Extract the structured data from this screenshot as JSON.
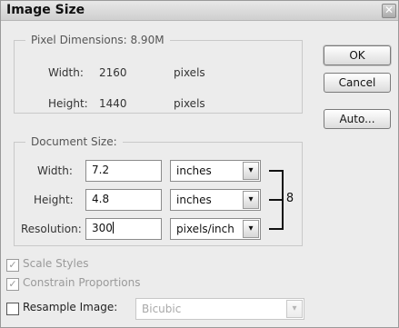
{
  "window": {
    "title": "Image Size",
    "close_glyph": "✕"
  },
  "pixel_dimensions": {
    "legend": "Pixel Dimensions:",
    "size": "8.90M",
    "width_label": "Width:",
    "width_value": "2160",
    "width_unit": "pixels",
    "height_label": "Height:",
    "height_value": "1440",
    "height_unit": "pixels"
  },
  "buttons": {
    "ok": "OK",
    "cancel": "Cancel",
    "auto": "Auto..."
  },
  "document_size": {
    "legend": "Document Size:",
    "width_label": "Width:",
    "width_value": "7.2",
    "width_unit": "inches",
    "height_label": "Height:",
    "height_value": "4.8",
    "height_unit": "inches",
    "resolution_label": "Resolution:",
    "resolution_value": "300",
    "resolution_unit": "pixels/inch"
  },
  "options": {
    "scale_styles": {
      "label": "Scale Styles",
      "checked": true,
      "enabled": false
    },
    "constrain_proportions": {
      "label": "Constrain Proportions",
      "checked": true,
      "enabled": false
    },
    "resample_image": {
      "label": "Resample Image:",
      "checked": false,
      "enabled": true,
      "method": "Bicubic"
    }
  },
  "glyphs": {
    "check": "✓",
    "dropdown": "▾",
    "chain": "8"
  },
  "icons": [
    "close-icon",
    "chevron-down-icon",
    "chain-link-icon",
    "checkmark-icon"
  ]
}
